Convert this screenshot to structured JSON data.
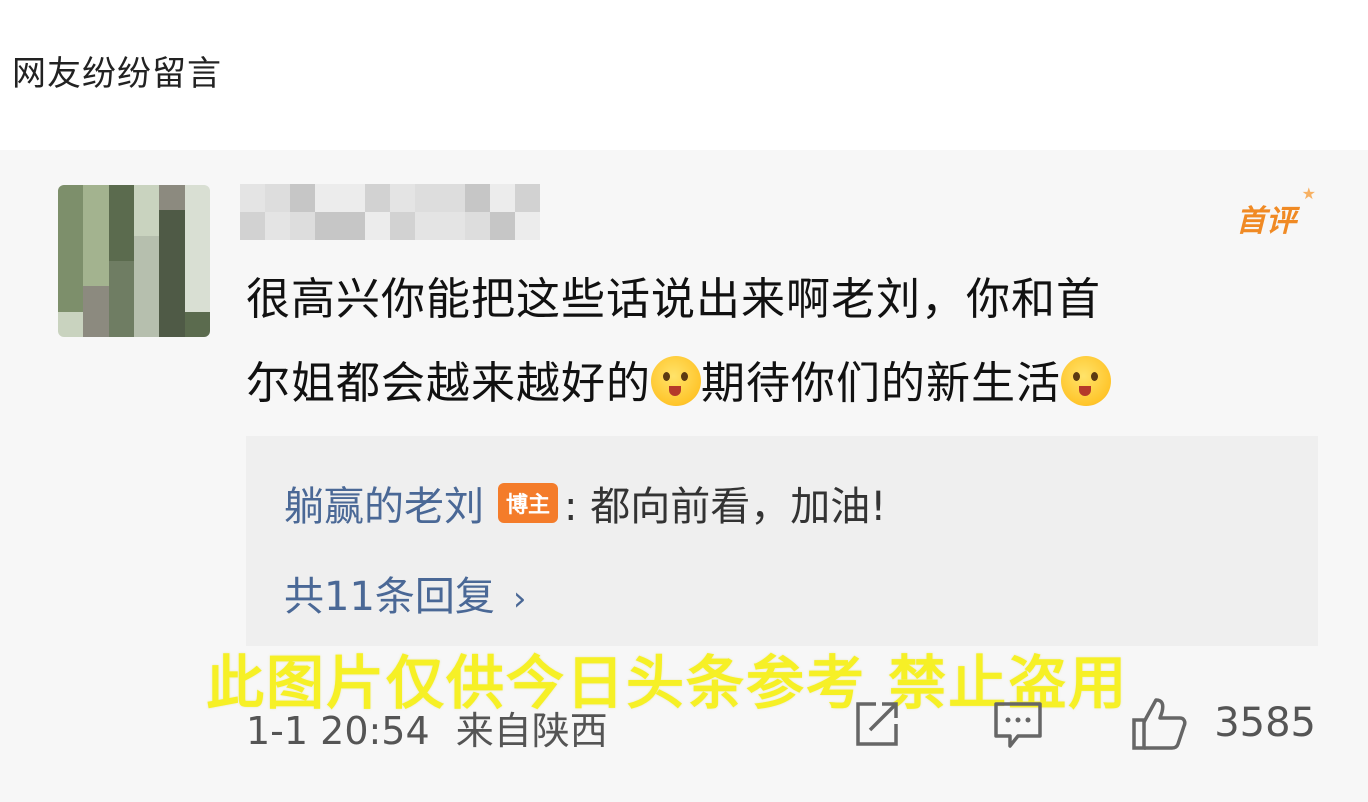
{
  "caption": "网友纷纷留言",
  "comment": {
    "badge": "首评",
    "text_line1": "很高兴你能把这些话说出来啊老刘，你和首",
    "text_line2_a": "尔姐都会越来越好的",
    "text_line2_b": "期待你们的新生活",
    "emoji_icon": "crying-laughing-emoji",
    "timestamp": "1-1 20:54",
    "location": "来自陕西",
    "likes": "3585"
  },
  "reply": {
    "author": "躺赢的老刘",
    "author_badge": "博主",
    "separator": ": ",
    "text": "都向前看，加油!",
    "count_label": "共11条回复"
  },
  "watermark": "此图片仅供今日头条参考 禁止盗用",
  "colors": {
    "badge_orange": "#f08a24",
    "link_blue": "#4a6896",
    "watermark_yellow": "#f6f026"
  }
}
